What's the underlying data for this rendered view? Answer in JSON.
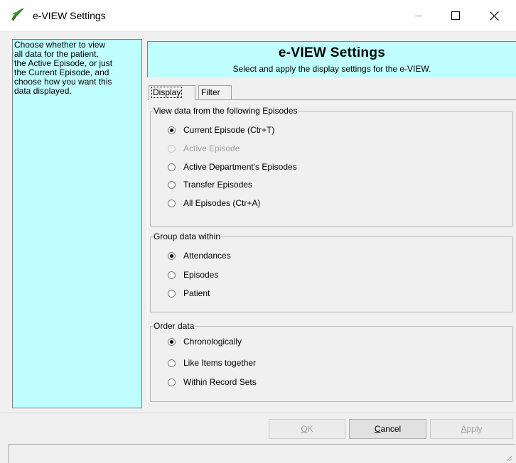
{
  "window": {
    "title": "e-VIEW Settings",
    "icon": "app-logo-icon",
    "controls": [
      "minimize-icon",
      "maximize-icon",
      "close-icon"
    ]
  },
  "help_text": "Choose whether to view\nall data for the patient,\nthe Active Episode, or just\nthe Current Episode, and\nchoose how you want this\ndata displayed.",
  "header": {
    "title": "e-VIEW Settings",
    "subtitle": "Select and apply the display settings for the e-VIEW."
  },
  "tabs": [
    {
      "label": "Display",
      "active": true
    },
    {
      "label": "Filter",
      "active": false
    }
  ],
  "groups": {
    "episodes": {
      "label": "View data from the following Episodes",
      "options": [
        {
          "label": "Current Episode (Ctr+T)",
          "checked": true,
          "disabled": false
        },
        {
          "label": "Active Episode",
          "checked": false,
          "disabled": true
        },
        {
          "label": "Active Department's Episodes",
          "checked": false,
          "disabled": false
        },
        {
          "label": "Transfer Episodes",
          "checked": false,
          "disabled": false
        },
        {
          "label": "All Episodes (Ctr+A)",
          "checked": false,
          "disabled": false
        }
      ]
    },
    "grouping": {
      "label": "Group data within",
      "options": [
        {
          "label": "Attendances",
          "checked": true,
          "disabled": false
        },
        {
          "label": "Episodes",
          "checked": false,
          "disabled": false
        },
        {
          "label": "Patient",
          "checked": false,
          "disabled": false
        }
      ]
    },
    "ordering": {
      "label": "Order data",
      "options": [
        {
          "label": "Chronologically",
          "checked": true,
          "disabled": false
        },
        {
          "label": "Like Items together",
          "checked": false,
          "disabled": false
        },
        {
          "label": "Within Record Sets",
          "checked": false,
          "disabled": false
        }
      ]
    }
  },
  "buttons": {
    "ok": {
      "mnemonic": "O",
      "rest": "K",
      "enabled": false
    },
    "cancel": {
      "mnemonic": "C",
      "rest": "ancel",
      "enabled": true
    },
    "apply": {
      "mnemonic": "A",
      "rest": "pply",
      "enabled": false
    }
  },
  "colors": {
    "panel_cyan": "#c0ffff",
    "window_bg": "#f0f0f0"
  }
}
